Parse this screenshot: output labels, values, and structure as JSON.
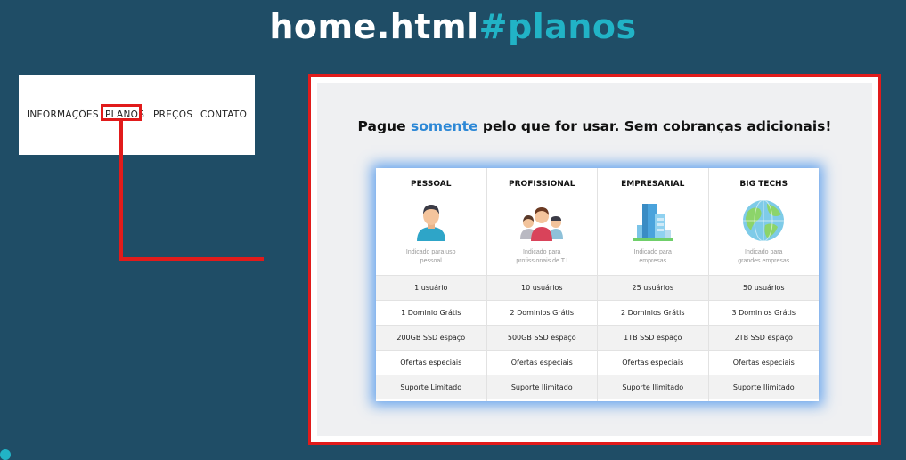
{
  "page": {
    "title_main": "home.html",
    "title_accent": "#planos",
    "accent_color": "#21b3c6",
    "highlight_color": "#e11b1b"
  },
  "nav": {
    "items": [
      "INFORMAÇÕES",
      "PLANOS",
      "PREÇOS",
      "CONTATO"
    ],
    "highlighted": "PLANOS"
  },
  "pricing": {
    "headline_before": "Pague ",
    "headline_highlight": "somente",
    "headline_after": " pelo que for usar. Sem cobranças adicionais!",
    "plans": [
      {
        "name": "PESSOAL",
        "icon": "person-icon",
        "desc_line1": "Indicado para uso",
        "desc_line2": "pessoal",
        "features": [
          "1 usuário",
          "1 Dominio Grátis",
          "200GB SSD espaço",
          "Ofertas especiais",
          "Suporte Limitado"
        ]
      },
      {
        "name": "PROFISSIONAL",
        "icon": "team-icon",
        "desc_line1": "Indicado para",
        "desc_line2": "profissionais de T.I",
        "features": [
          "10 usuários",
          "2 Dominios Grátis",
          "500GB SSD espaço",
          "Ofertas especiais",
          "Suporte Ilimitado"
        ]
      },
      {
        "name": "EMPRESARIAL",
        "icon": "building-icon",
        "desc_line1": "Indicado para",
        "desc_line2": "empresas",
        "features": [
          "25 usuários",
          "2 Dominios Grátis",
          "1TB SSD espaço",
          "Ofertas especiais",
          "Suporte Ilimitado"
        ]
      },
      {
        "name": "BIG TECHS",
        "icon": "globe-icon",
        "desc_line1": "Indicado para",
        "desc_line2": "grandes empresas",
        "features": [
          "50 usuários",
          "3 Dominios Grátis",
          "2TB SSD espaço",
          "Ofertas especiais",
          "Suporte Ilimitado"
        ]
      }
    ]
  }
}
